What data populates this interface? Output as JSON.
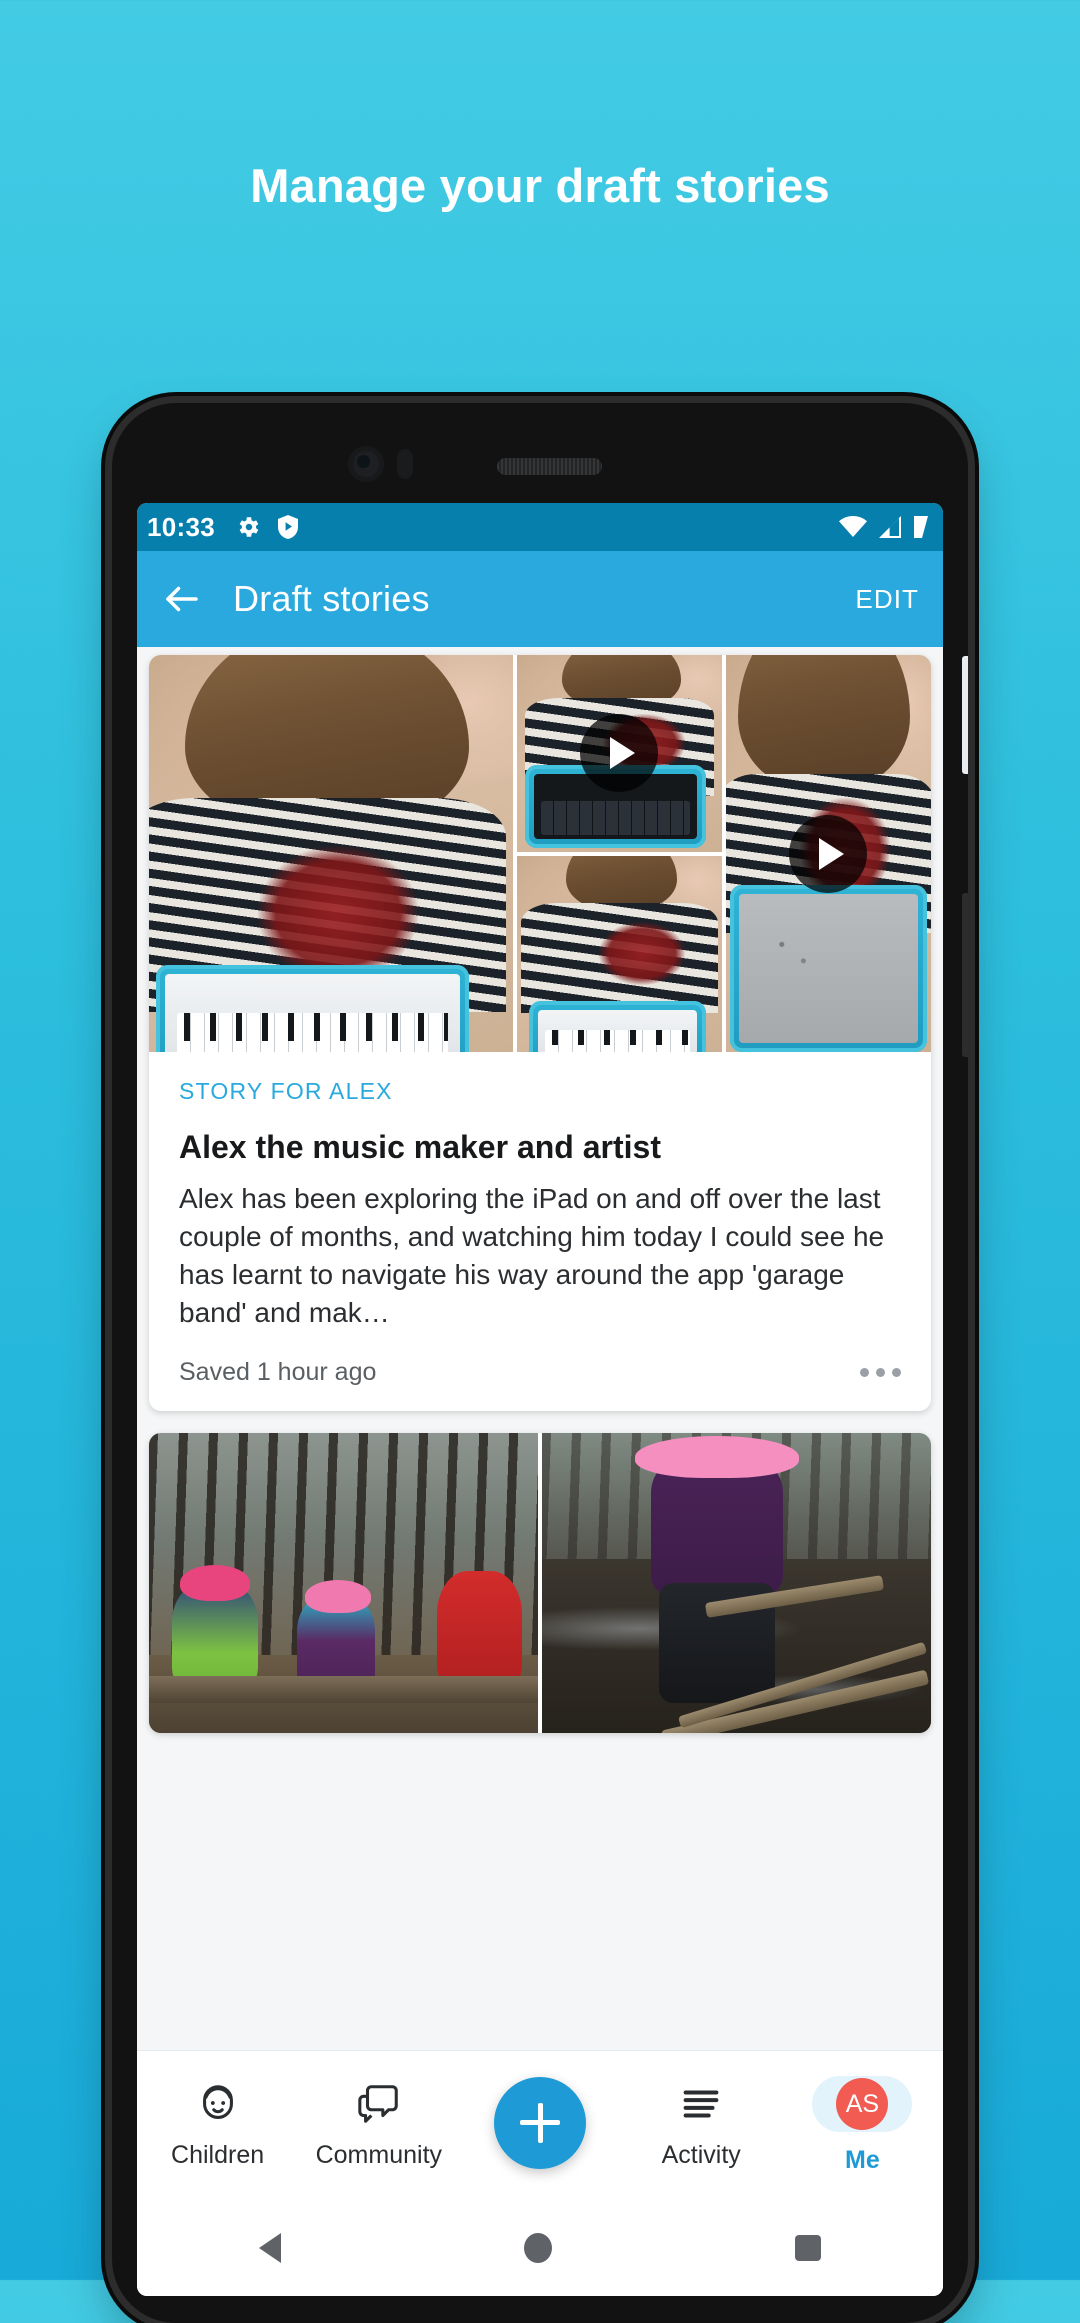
{
  "promo": {
    "title": "Manage your draft stories"
  },
  "statusbar": {
    "time": "10:33",
    "icons_left": [
      "gear-icon",
      "shield-play-icon"
    ],
    "icons_right": [
      "wifi-icon",
      "signal-icon",
      "battery-icon"
    ]
  },
  "appbar": {
    "back": "back-arrow-icon",
    "title": "Draft stories",
    "edit_label": "EDIT"
  },
  "stories": [
    {
      "eyebrow": "STORY FOR ALEX",
      "title": "Alex the music maker and artist",
      "text": "Alex has been exploring the iPad on and off over the last couple of months, and watching him today I could see he has learnt to navigate his way around the app 'garage band' and mak…",
      "saved": "Saved 1 hour ago",
      "more": "more-options-icon",
      "media": [
        {
          "kind": "photo",
          "alt": "child using tablet keyboard"
        },
        {
          "kind": "video",
          "alt": "child tapping tablet piano app"
        },
        {
          "kind": "photo",
          "alt": "child playing keyboard on tablet"
        },
        {
          "kind": "video",
          "alt": "child drawing on magnetic board"
        }
      ]
    },
    {
      "media": [
        {
          "kind": "photo",
          "alt": "three children sitting on log in forest"
        },
        {
          "kind": "photo",
          "alt": "child walking on planks in muddy forest"
        }
      ]
    }
  ],
  "bottomnav": {
    "items": [
      {
        "label": "Children",
        "icon": "child-face-icon",
        "active": false
      },
      {
        "label": "Community",
        "icon": "chat-bubbles-icon",
        "active": false
      },
      {
        "label": "Activity",
        "icon": "list-lines-icon",
        "active": false
      },
      {
        "label": "Me",
        "icon": "avatar-icon",
        "active": true
      }
    ],
    "fab": {
      "icon": "plus-icon",
      "label": "+"
    },
    "avatar_initials": "AS"
  },
  "androidnav": {
    "back": "triangle-back-icon",
    "home": "circle-home-icon",
    "recents": "square-recents-icon"
  },
  "colors": {
    "brand": "#29a9dd",
    "statusbar": "#077fad",
    "accent_link": "#29a9dd",
    "avatar": "#f15b52",
    "background_top": "#43cbe4",
    "background_bottom": "#18aad8"
  }
}
